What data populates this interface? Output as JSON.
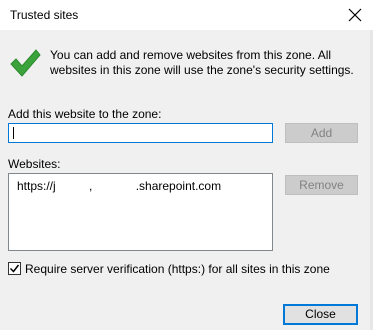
{
  "window": {
    "title": "Trusted sites"
  },
  "info": {
    "message": "You can add and remove websites from this zone. All websites in this zone will use the zone's security settings."
  },
  "add_section": {
    "label": "Add this website to the zone:",
    "input_value": "",
    "add_label": "Add"
  },
  "websites_section": {
    "label": "Websites:",
    "items": [
      "https://j          ,             .sharepoint.com"
    ],
    "remove_label": "Remove"
  },
  "verification": {
    "label": "Require server verification (https:) for all sites in this zone",
    "checked": true
  },
  "footer": {
    "close_label": "Close"
  },
  "colors": {
    "focus_blue": "#0078d7",
    "check_green": "#3ba33b"
  },
  "icons": {
    "info": "green-checkmark-icon",
    "close": "close-icon",
    "checkbox": "checkbox-checked-icon"
  }
}
